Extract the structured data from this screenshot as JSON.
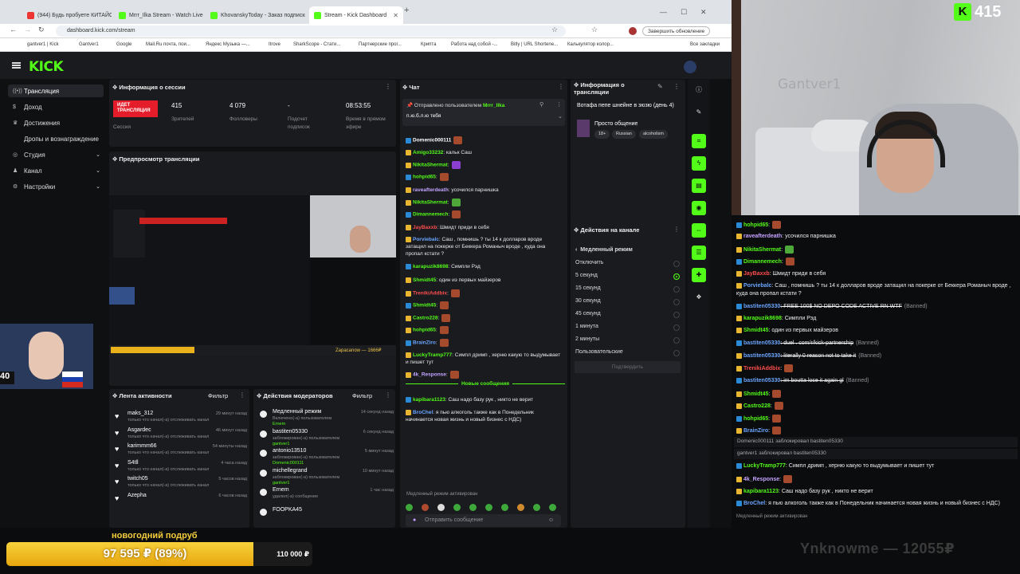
{
  "browser": {
    "tabs": [
      {
        "label": "(944) Будь пробуете КИТАЙСКИЕ...",
        "color": "#e33"
      },
      {
        "label": "Mrrr_Ilka Stream - Watch Live on Kick",
        "color": "#53fc18"
      },
      {
        "label": "KhovanskyToday - Заказ подписки",
        "color": "#53fc18"
      },
      {
        "label": "Stream - Kick Dashboard",
        "color": "#53fc18"
      }
    ],
    "url": "dashboard.kick.com/stream",
    "update_button": "Завершить обновление",
    "bookmarks": [
      "gantver1 | Kick",
      "Gantver1",
      "Google",
      "Mail.Ru почта, пои...",
      "Яндекс Музыка —...",
      "Itrove",
      "SharkScope - Стати...",
      "Партнерские прог...",
      "Крипта",
      "Работа над собой -...",
      "Bitly | URL Shortene...",
      "Калькулятор колор...",
      "Все закладки"
    ]
  },
  "kick": {
    "logo": "KICK",
    "sidebar": [
      {
        "label": "Трансляция",
        "icon": "broadcast-icon",
        "active": true
      },
      {
        "label": "Доход",
        "icon": "dollar-icon"
      },
      {
        "label": "Достижения",
        "icon": "trophy-icon"
      },
      {
        "label": "Дропы и вознаграждение",
        "icon": ""
      },
      {
        "label": "Студия",
        "icon": "studio-icon",
        "chev": "⌄"
      },
      {
        "label": "Канал",
        "icon": "channel-icon",
        "chev": "⌄"
      },
      {
        "label": "Настройки",
        "icon": "settings-icon",
        "chev": "⌄"
      }
    ],
    "session": {
      "title": "Информация о сессии",
      "live_badge": "ИДЕТ ТРАНСЛЯЦИЯ",
      "live_label": "Сессия",
      "viewers": "415",
      "viewers_label": "Зрителей",
      "followers": "4 079",
      "followers_label": "Фолловеры",
      "subs": "-",
      "subs_label": "Подсчет подписок",
      "uptime": "08:53:55",
      "uptime_label": "Время в прямом эфире"
    },
    "preview": {
      "title": "Предпросмотр трансляции",
      "donor": "Zapacanow — 1666₽"
    },
    "activity": {
      "title": "Лента активности",
      "filter": "Фильтр",
      "items": [
        {
          "name": "maks_312",
          "sub": "только что начал(-а) отслеживать канал",
          "time": "29 минут назад"
        },
        {
          "name": "Asgardec",
          "sub": "только что начал(-а) отслеживать канал",
          "time": "46 минут назад"
        },
        {
          "name": "karimmm66",
          "sub": "только что начал(-а) отслеживать канал",
          "time": "54 минуты назад"
        },
        {
          "name": "S4tll",
          "sub": "только что начал(-а) отслеживать канал",
          "time": "4 часа назад"
        },
        {
          "name": "twitch05",
          "sub": "только что начал(-а) отслеживать канал",
          "time": "5 часов назад"
        },
        {
          "name": "Azepha",
          "sub": "",
          "time": "6 часов назад"
        }
      ]
    },
    "mod": {
      "title": "Действия модераторов",
      "filter": "Фильтр",
      "items": [
        {
          "name": "Медленный режим",
          "sub": "Включено(-а) пользователем",
          "by": "Ernem",
          "time": "14 секунд назад"
        },
        {
          "name": "bastiten05330",
          "sub": "заблокирован(-а) пользователем",
          "by": "gantver1",
          "time": "6 секунд назад"
        },
        {
          "name": "antonio13510",
          "sub": "заблокирован(-а) пользователем",
          "by": "Domenic000111",
          "time": "5 минут назад"
        },
        {
          "name": "michellegrand",
          "sub": "заблокирован(-а) пользователем",
          "by": "gantver1",
          "time": "10 минут назад"
        },
        {
          "name": "Ernem",
          "sub": "удалил(-а) сообщение",
          "by": "",
          "time": "1 час назад"
        },
        {
          "name": "FOOPKA45",
          "sub": "",
          "by": "",
          "time": ""
        }
      ]
    },
    "chat": {
      "title": "Чат",
      "pinned_by_label": "Отправлено пользователем",
      "pinned_by": "Mrrr_Ilka",
      "pinned_text": "п.ю.б.л.ю тебя",
      "new_messages": "Новые сообщения",
      "slow_mode": "Медленный режим активирован",
      "placeholder": "Отправить сообщение",
      "lines": [
        {
          "user": "Domenic000111",
          "color": "#fff",
          "text": "",
          "emote": "r"
        },
        {
          "user": "Amigo33232",
          "color": "#53fc18",
          "text": ": кальк Саш"
        },
        {
          "user": "NikitaShermat",
          "color": "#53fc18",
          "text": ":",
          "emote": "p"
        },
        {
          "user": "hohpid65",
          "color": "#53fc18",
          "text": ":",
          "emote": "r"
        },
        {
          "user": "raveafterdeath",
          "color": "#c4a3ff",
          "text": ": усочился парнишка"
        },
        {
          "user": "NikitaShermat",
          "color": "#53fc18",
          "text": ":",
          "emote": "g"
        },
        {
          "user": "Dimannemech",
          "color": "#53fc18",
          "text": ":",
          "emote": "r"
        },
        {
          "user": "JayBaxxb",
          "color": "#ff4d4d",
          "text": ": Шмидт приди в себя"
        },
        {
          "user": "Porviebalc",
          "color": "#6aa5ff",
          "text": ": Саш , помнишь ? ты 14 к долларов вроде затащил на покерке от Беккера Романыч вроде , куда она пропал кстати ?"
        },
        {
          "user": "karapuzik8698",
          "color": "#53fc18",
          "text": ": Симпли Рэд"
        },
        {
          "user": "Shmidt45",
          "color": "#53fc18",
          "text": ": один из первых майзеров"
        },
        {
          "user": "TrenikiAddbix",
          "color": "#ff4d4d",
          "text": ":",
          "emote": "r"
        },
        {
          "user": "Shmidt45",
          "color": "#53fc18",
          "text": ":",
          "emote": "r"
        },
        {
          "user": "Castro228",
          "color": "#53fc18",
          "text": ":",
          "emote": "r"
        },
        {
          "user": "hohpid65",
          "color": "#53fc18",
          "text": ":",
          "emote": "r"
        },
        {
          "user": "BrainZiro",
          "color": "#6aa5ff",
          "text": ":",
          "emote": "r"
        },
        {
          "user": "LuckyTramp777",
          "color": "#53fc18",
          "text": ": Симпл дримп , херню какую то выдумывает и пишет тут"
        },
        {
          "user": "4k_Response",
          "color": "#c4a3ff",
          "text": ":",
          "emote": "r"
        }
      ],
      "new_lines": [
        {
          "user": "kapibara1123",
          "color": "#53fc18",
          "text": ": Саш надо базу рук , никто не верит"
        },
        {
          "user": "BroChel",
          "color": "#6aa5ff",
          "text": ": я пью алкоголь также как в Понедельник начинается новая жизнь и новый бизнес с НДС)"
        }
      ]
    },
    "stream_info": {
      "title": "Информация о трансляции",
      "stream_title": "Вотафа пепе шнейне в зюзю (день 4)",
      "category": "Просто общение",
      "tags": [
        "18+",
        "Russian",
        "alcoholism"
      ]
    },
    "channel_actions": {
      "title": "Действия на канале",
      "section": "Медленный режим",
      "options": [
        "Отключить",
        "5 секунд",
        "15 секунд",
        "30 секунд",
        "45 секунд",
        "1 минута",
        "2 минуты",
        "Пользовательские"
      ],
      "selected_index": 1,
      "confirm": "Подтвердить"
    }
  },
  "overlay": {
    "viewer_count": "415",
    "watermark": "Gantver1",
    "chat": [
      {
        "user": "hohpid65",
        "color": "#53fc18",
        "text": ":",
        "emote": "r"
      },
      {
        "user": "raveafterdeath",
        "color": "#c4a3ff",
        "text": ": усочился парнишка"
      },
      {
        "user": "NikitaShermat",
        "color": "#53fc18",
        "text": ":",
        "emote": "g"
      },
      {
        "user": "Dimannemech",
        "color": "#53fc18",
        "text": ":",
        "emote": "r"
      },
      {
        "user": "JayBaxxb",
        "color": "#ff4d4d",
        "text": ": Шмидт приди в себя"
      },
      {
        "user": "Porviebalc",
        "color": "#6aa5ff",
        "text": ": Саш , помнишь ? ты 14 к долларов вроде затащил на покерке от Беккера Романыч вроде , куда она пропал кстати ?"
      },
      {
        "user": "bastiten05330",
        "color": "#6aa5ff",
        "text": ": FREE 100$ NO DEPO CODE ACTIVE RN WTF",
        "banned": "(Banned)"
      },
      {
        "user": "karapuzik8698",
        "color": "#53fc18",
        "text": ": Симпли Рэд"
      },
      {
        "user": "Shmidt45",
        "color": "#53fc18",
        "text": ": один из первых майзеров"
      },
      {
        "user": "bastiten05330",
        "color": "#6aa5ff",
        "text": ": duel . com/r/kick-partnership",
        "banned": "(Banned)"
      },
      {
        "user": "bastiten05330",
        "color": "#6aa5ff",
        "text": ": literally 0 reason not to take it",
        "banned": "(Banned)"
      },
      {
        "user": "TrenikiAddbix",
        "color": "#ff4d4d",
        "text": ":",
        "emote": "r"
      },
      {
        "user": "bastiten05330",
        "color": "#6aa5ff",
        "text": ": im boutta lose it again gl",
        "banned": "(Banned)"
      },
      {
        "user": "Shmidt45",
        "color": "#53fc18",
        "text": ":",
        "emote": "r"
      },
      {
        "user": "Castro228",
        "color": "#53fc18",
        "text": ":",
        "emote": "r"
      },
      {
        "user": "hohpid65",
        "color": "#53fc18",
        "text": ":",
        "emote": "r"
      },
      {
        "user": "BrainZiro",
        "color": "#6aa5ff",
        "text": ":",
        "emote": "r"
      }
    ],
    "bans": [
      "Domenic000111 заблокировал bastiten05330",
      "gantver1 заблокировал bastiten05330"
    ],
    "chat2": [
      {
        "user": "LuckyTramp777",
        "color": "#53fc18",
        "text": ": Симпл дримп , херню какую то выдумывает и пишет тут"
      },
      {
        "user": "4k_Response",
        "color": "#c4a3ff",
        "text": ":",
        "emote": "r"
      },
      {
        "user": "kapibara1123",
        "color": "#53fc18",
        "text": ": Саш надо базу рук , никто не верит"
      },
      {
        "user": "BroChel",
        "color": "#6aa5ff",
        "text": ": я пью алкоголь также как в Понедельник начинается новая жизнь и новый бизнес с НДС)"
      }
    ],
    "slow_mode": "Медленный режим активирован",
    "goal": {
      "title": "новогодний подруб",
      "current": "97 595 ₽ (89%)",
      "target": "110 000 ₽",
      "fraction": 0.89
    },
    "last_donor": "Ynknowme — 12055₽",
    "minicam_tag": "40"
  }
}
